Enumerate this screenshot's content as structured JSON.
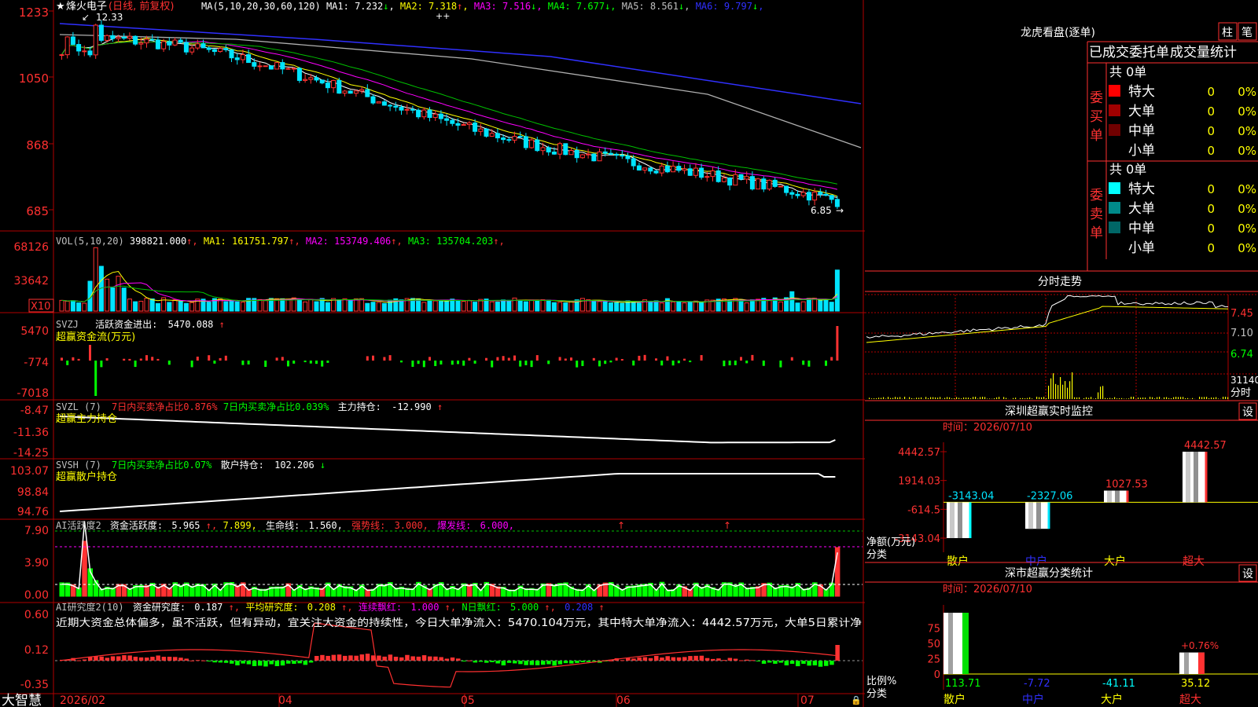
{
  "stock": {
    "name": "烽火电子",
    "mode": "(日线, 前复权)",
    "high_marker": "12.33",
    "low_marker": "6.85"
  },
  "colors": {
    "up": "#ff3232",
    "down": "#00e4ff",
    "flat": "#ffffff",
    "grid": "#b00000",
    "ma_yellow": "#ffff00",
    "ma_magenta": "#ff00ff",
    "ma_green": "#00c000",
    "ma_blue": "#3030ff"
  },
  "price_panel": {
    "ma_header": "MA(5,10,20,30,60,120)",
    "ma": [
      {
        "label": "MA1:",
        "value": "7.232",
        "arrow": "↓",
        "color": "#ffffff"
      },
      {
        "label": "MA2:",
        "value": "7.318",
        "arrow": "↑",
        "color": "#ffff00"
      },
      {
        "label": "MA3:",
        "value": "7.516",
        "arrow": "↓",
        "color": "#ff00ff"
      },
      {
        "label": "MA4:",
        "value": "7.677",
        "arrow": "↓",
        "color": "#00ff00"
      },
      {
        "label": "MA5:",
        "value": "8.561",
        "arrow": "↓",
        "color": "#c0c0c0"
      },
      {
        "label": "MA6:",
        "value": "9.797",
        "arrow": "↓",
        "color": "#3030ff"
      }
    ],
    "yticks": [
      "1233",
      "1050",
      "868",
      "685"
    ],
    "ylim": [
      6.5,
      12.5
    ]
  },
  "vol_panel": {
    "header": "VOL(5,10,20)",
    "value": "398821.000",
    "ma": [
      {
        "label": "MA1:",
        "value": "161751.797",
        "arrow": "↑",
        "color": "#ffff00"
      },
      {
        "label": "MA2:",
        "value": "153749.406",
        "arrow": "↑",
        "color": "#ff00ff"
      },
      {
        "label": "MA3:",
        "value": "135704.203",
        "arrow": "↑",
        "color": "#00ff00"
      }
    ],
    "yticks": [
      "68126",
      "33642"
    ],
    "multiplier": "X10"
  },
  "svzj_panel": {
    "header": "SVZJ",
    "label": "活跃资金进出:",
    "value": "5470.088",
    "arrow": "↑",
    "subtitle": "超赢资金流(万元)",
    "yticks": [
      "5470",
      "-774",
      "-7018"
    ]
  },
  "svzl_panel": {
    "header": "SVZL (7)",
    "t1": "7日内买卖净占比0.876%",
    "t2": "7日内买卖净占比0.039%",
    "t3": "主力持仓:",
    "value": "-12.990",
    "arrow": "↑",
    "subtitle": "超赢主力持仓",
    "yticks": [
      "-8.47",
      "-11.36",
      "-14.25"
    ]
  },
  "svsh_panel": {
    "header": "SVSH (7)",
    "t1": "7日内买卖净占比0.07%",
    "t2": "散户持仓:",
    "value": "102.206",
    "arrow": "↓",
    "subtitle": "超赢散户持仓",
    "yticks": [
      "103.07",
      "98.84",
      "94.76"
    ]
  },
  "ai_active_panel": {
    "header": "AI活跃度2",
    "t1": "资金活跃度:",
    "v1": "5.965",
    "v2": "7.899,",
    "t2": "生命线:",
    "v3": "1.560,",
    "t3": "强势线:",
    "v4": "3.000,",
    "t4": "爆发线:",
    "v5": "6.000,",
    "yticks": [
      "7.90",
      "3.90",
      "0.00"
    ]
  },
  "ai_research_panel": {
    "header": "AI研究度2(10)",
    "t1": "资金研究度:",
    "v1": "0.187",
    "t2": "平均研究度:",
    "v2": "0.208",
    "t3": "连续飘红:",
    "v3": "1.000",
    "t4": "N日飘红:",
    "v4": "5.000",
    "v5": "0.208",
    "comment": "近期大资金总体偏多，虽不活跃，但有异动，宜关注大资金的持续性，今日大单净流入：5470.104万元，其中特大单净流入：4442.57万元，大单5日累计净",
    "yticks": [
      "0.60",
      "0.12",
      "-0.35"
    ]
  },
  "xaxis": {
    "brand": "大智慧",
    "labels": [
      "2026/02",
      "04",
      "05",
      "06",
      "07"
    ]
  },
  "dragon_panel": {
    "title": "龙虎看盘(逐单)",
    "btn1": "柱",
    "btn2": "笔",
    "tabs": [
      "已成交",
      "委托单",
      "成交量统计"
    ],
    "buy_title": "委买单",
    "sell_title": "委卖单",
    "buy_total": "共 0单",
    "sell_total": "共 0单",
    "buy_rows": [
      {
        "label": "特大",
        "count": "0",
        "pct": "0%",
        "color": "#ff0000"
      },
      {
        "label": "大单",
        "count": "0",
        "pct": "0%",
        "color": "#a00000"
      },
      {
        "label": "中单",
        "count": "0",
        "pct": "0%",
        "color": "#700000"
      },
      {
        "label": "小单",
        "count": "0",
        "pct": "0%",
        "color": "#000000"
      }
    ],
    "sell_rows": [
      {
        "label": "特大",
        "count": "0",
        "pct": "0%",
        "color": "#00ffff"
      },
      {
        "label": "大单",
        "count": "0",
        "pct": "0%",
        "color": "#008a8a"
      },
      {
        "label": "中单",
        "count": "0",
        "pct": "0%",
        "color": "#006666"
      },
      {
        "label": "小单",
        "count": "0",
        "pct": "0%",
        "color": "#000000"
      }
    ]
  },
  "intraday_panel": {
    "title": "分时走势",
    "yticks": [
      "7.45",
      "7.10",
      "6.74"
    ],
    "vol_label": "31140",
    "vol_unit": "分时"
  },
  "sz_monitor": {
    "title": "深圳超赢实时监控",
    "set_btn": "设",
    "time_label": "时间：2026/07/10",
    "yticks": [
      "4442.57",
      "1914.03",
      "-614.5",
      "-3143.04"
    ],
    "ylabel": "净额(万元)",
    "xlabel_title": "分类",
    "chart_data": {
      "type": "bar",
      "categories": [
        "散户",
        "中户",
        "大户",
        "超大"
      ],
      "values": [
        -3143.04,
        -2327.06,
        1027.53,
        4442.57
      ],
      "value_labels": [
        "-3143.04",
        "-2327.06",
        "1027.53",
        "4442.57"
      ],
      "ylim": [
        -3143.04,
        4442.57
      ]
    }
  },
  "sz_class": {
    "title": "深市超赢分类统计",
    "set_btn": "设",
    "time_label": "时间：2026/07/10",
    "yticks": [
      "75",
      "50",
      "25",
      "0"
    ],
    "ylabel": "比例%",
    "xlabel_title": "分类",
    "overlay_label": "+0.76%",
    "chart_data": {
      "type": "bar",
      "categories": [
        "散户",
        "中户",
        "大户",
        "超大"
      ],
      "values": [
        113.71,
        -7.72,
        -41.11,
        35.12
      ],
      "value_labels": [
        "113.71",
        "-7.72",
        "-41.11",
        "35.12"
      ],
      "ylim": [
        0,
        100
      ]
    }
  }
}
